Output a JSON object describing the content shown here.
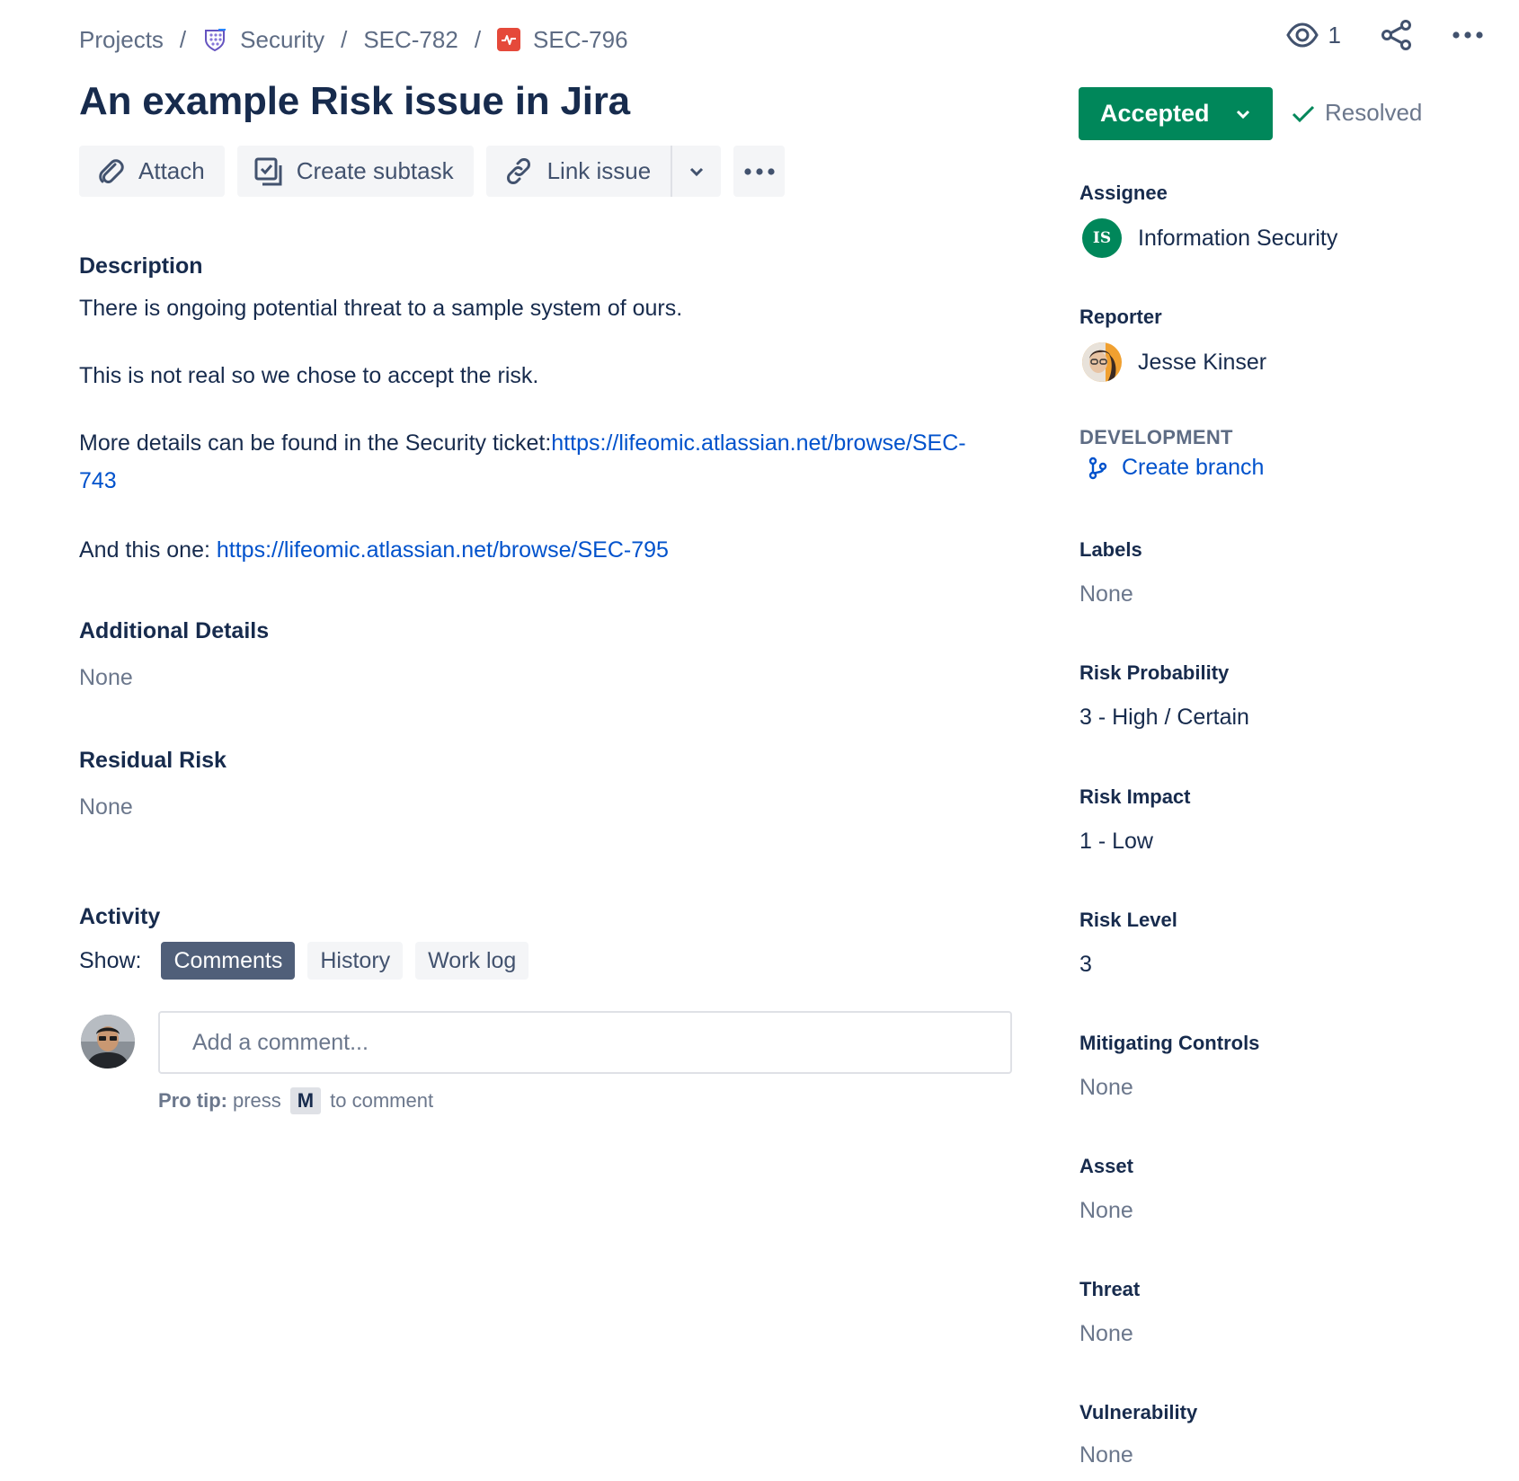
{
  "breadcrumbs": {
    "projects": "Projects",
    "project": "Security",
    "parent": "SEC-782",
    "issue": "SEC-796",
    "separator": "/"
  },
  "top_actions": {
    "watch_count": "1",
    "watch_icon": "eye-icon",
    "share_icon": "share-icon",
    "more_icon": "more-icon"
  },
  "issue": {
    "title": "An example Risk issue in Jira"
  },
  "toolbar": {
    "attach": "Attach",
    "create_subtask": "Create subtask",
    "link_issue": "Link issue"
  },
  "description": {
    "heading": "Description",
    "p1": "There is ongoing potential threat to a sample system of ours.",
    "p2": "This is not real so we chose to accept the risk.",
    "p3_prefix": "More details can be found in the Security ticket:",
    "p3_link_part1": "https://lifeomic.atlassian.net/browse/SEC-",
    "p3_link_part2": "743",
    "p4_prefix": "And this one: ",
    "p4_link": "https://lifeomic.atlassian.net/browse/SEC-795"
  },
  "additional_details": {
    "heading": "Additional Details",
    "value": "None"
  },
  "residual_risk": {
    "heading": "Residual Risk",
    "value": "None"
  },
  "activity": {
    "heading": "Activity",
    "show_label": "Show:",
    "tabs": [
      "Comments",
      "History",
      "Work log"
    ],
    "active_tab": "Comments",
    "comment_placeholder": "Add a comment...",
    "protip_label": "Pro tip:",
    "protip_press": "press",
    "protip_key": "M",
    "protip_suffix": "to comment"
  },
  "status": {
    "label": "Accepted",
    "resolution": "Resolved",
    "color": "#00875a"
  },
  "fields": {
    "assignee_label": "Assignee",
    "assignee_initials": "IS",
    "assignee": "Information Security",
    "reporter_label": "Reporter",
    "reporter": "Jesse Kinser",
    "development_label": "DEVELOPMENT",
    "create_branch": "Create branch",
    "labels_label": "Labels",
    "labels_value": "None",
    "risk_probability_label": "Risk Probability",
    "risk_probability_value": "3 - High / Certain",
    "risk_impact_label": "Risk Impact",
    "risk_impact_value": "1 - Low",
    "risk_level_label": "Risk Level",
    "risk_level_value": "3",
    "mitigating_controls_label": "Mitigating Controls",
    "mitigating_controls_value": "None",
    "asset_label": "Asset",
    "asset_value": "None",
    "threat_label": "Threat",
    "threat_value": "None",
    "vulnerability_label": "Vulnerability",
    "vulnerability_value": "None"
  },
  "colors": {
    "link": "#0052cc",
    "text": "#172b4d",
    "muted": "#6b778c",
    "button_bg": "#f4f5f7",
    "tab_active": "#505f79"
  }
}
